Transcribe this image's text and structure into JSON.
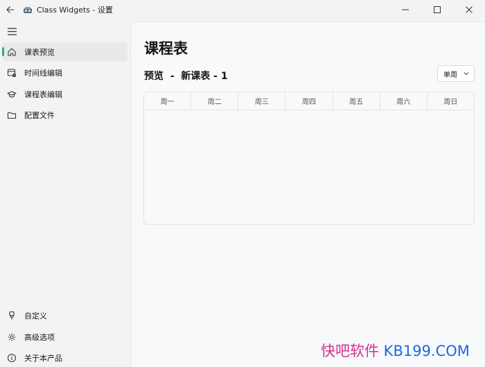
{
  "window": {
    "title": "Class Widgets - 设置"
  },
  "sidebar": {
    "items": [
      {
        "label": "课表预览",
        "active": true,
        "icon": "home-icon"
      },
      {
        "label": "时间线编辑",
        "active": false,
        "icon": "timeline-icon"
      },
      {
        "label": "课程表编辑",
        "active": false,
        "icon": "graduation-cap-icon"
      },
      {
        "label": "配置文件",
        "active": false,
        "icon": "folder-icon"
      }
    ],
    "bottom_items": [
      {
        "label": "自定义",
        "icon": "brush-icon"
      },
      {
        "label": "高级选项",
        "icon": "gear-icon"
      },
      {
        "label": "关于本产品",
        "icon": "info-icon"
      }
    ]
  },
  "main": {
    "title": "课程表",
    "subtitle": "预览  -  新课表 - 1",
    "week_select": "单周",
    "table": {
      "headers": [
        "周一",
        "周二",
        "周三",
        "周四",
        "周五",
        "周六",
        "周日"
      ]
    }
  },
  "watermark": {
    "cn": "快吧软件",
    "en": " KB199.COM"
  },
  "colors": {
    "accent": "#2fb36a",
    "watermark_cn": "#d42f8f",
    "watermark_en": "#1e68d8"
  }
}
